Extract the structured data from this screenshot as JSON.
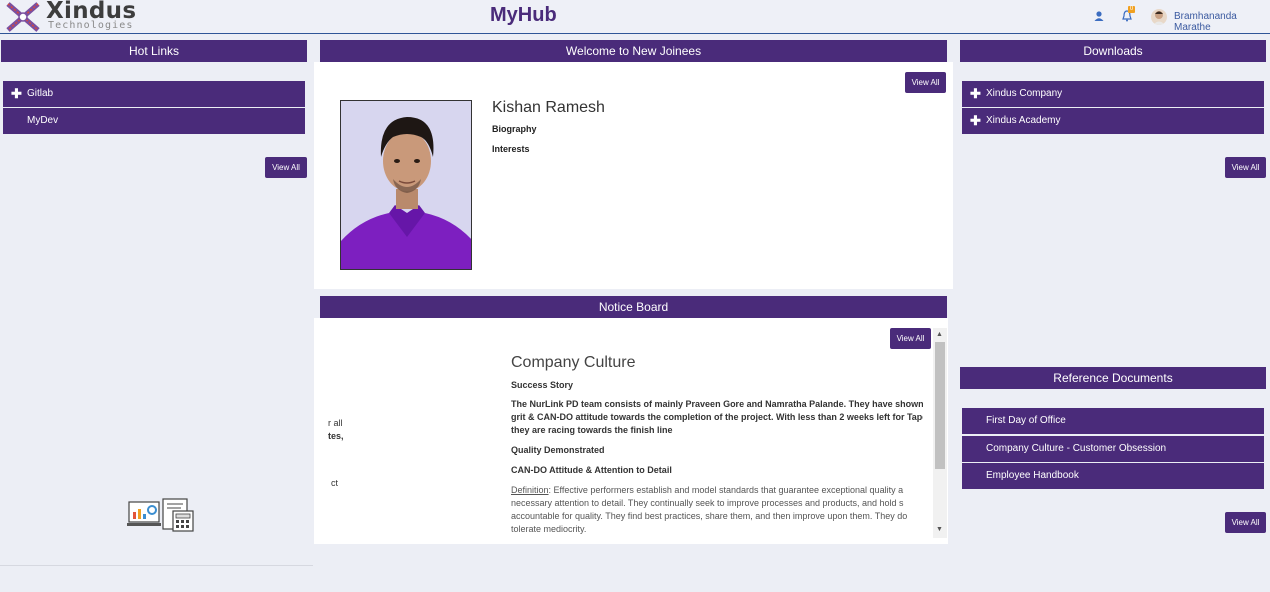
{
  "header": {
    "logo_name": "Xindus",
    "logo_sub": "Technologies",
    "app_title": "MyHub",
    "user_icon": "user-icon",
    "bell_icon": "bell-icon",
    "notification_count": "0",
    "user_name": "Bramhananda Marathe"
  },
  "hot_links": {
    "title": "Hot Links",
    "items": [
      {
        "label": "Gitlab",
        "icon": "plus-icon"
      },
      {
        "label": "MyDev"
      }
    ],
    "view_all": "View All"
  },
  "welcome": {
    "title": "Welcome to New Joinees",
    "view_all": "View All",
    "name": "Kishan Ramesh",
    "biography_label": "Biography",
    "interests_label": "Interests"
  },
  "notice_board": {
    "title": "Notice Board",
    "view_all": "View All",
    "side_fragments": [
      "r all",
      "tes,",
      "ct"
    ],
    "heading": "Company Culture",
    "success_label": "Success Story",
    "story_lines": [
      "The NurLink PD team consists of mainly Praveen Gore and Namratha  Palande. They have shown t",
      "grit & CAN-DO attitude towards the completion of the project. With less than 2 weeks left for Tape O",
      "they are racing towards the finish line"
    ],
    "quality_label": "Quality Demonstrated",
    "attitude_label": "CAN-DO Attitude & Attention to Detail",
    "definition_label": "Definition",
    "definition_lines": [
      ": Effective performers establish and model standards that guarantee exceptional quality a",
      "necessary attention to detail. They continually seek to improve processes and products, and hold s",
      "accountable for quality. They find best practices, share them, and then improve upon them. They do",
      "tolerate mediocrity."
    ]
  },
  "downloads": {
    "title": "Downloads",
    "items": [
      {
        "label": "Xindus Company",
        "icon": "plus-icon"
      },
      {
        "label": "Xindus Academy",
        "icon": "plus-icon"
      }
    ],
    "view_all": "View All"
  },
  "reference_documents": {
    "title": "Reference Documents",
    "items": [
      {
        "label": "First Day of Office"
      },
      {
        "label": "Company Culture - Customer Obsession"
      },
      {
        "label": "Employee Handbook"
      }
    ],
    "view_all": "View All"
  },
  "colors": {
    "brand_purple": "#4a2b7a",
    "accent_blue": "#2f5597",
    "badge_orange": "#f0a020"
  }
}
